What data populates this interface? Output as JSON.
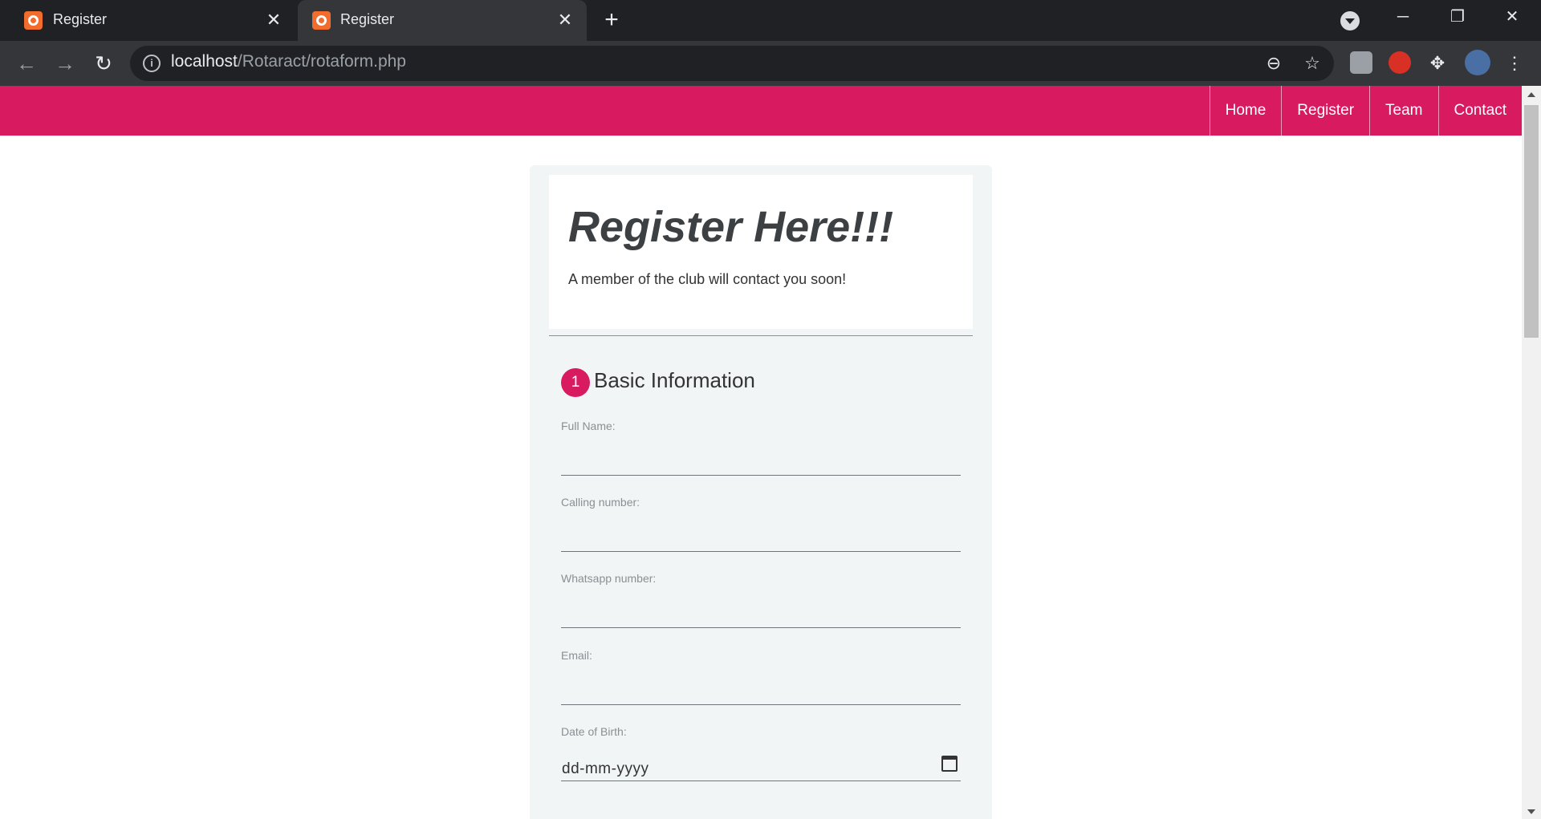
{
  "browser": {
    "tabs": [
      {
        "title": "Register",
        "active": false
      },
      {
        "title": "Register",
        "active": true
      }
    ],
    "url_host": "localhost",
    "url_path": "/Rotaract/rotaform.php",
    "icons": {
      "tab_close": "✕",
      "new_tab": "+",
      "back": "←",
      "forward": "→",
      "reload": "↻",
      "info": "i",
      "zoom": "⊖",
      "star": "☆",
      "puzzle": "✥",
      "menu": "⋮",
      "minimize": "─",
      "restore": "❐",
      "close": "✕"
    }
  },
  "nav": {
    "items": [
      "Home",
      "Register",
      "Team",
      "Contact"
    ],
    "accent": "#d81b60"
  },
  "form": {
    "title": "Register Here!!!",
    "subtitle": "A member of the club will contact you soon!",
    "section_number": "1",
    "section_title": "Basic Information",
    "fields": {
      "full_name": "Full Name:",
      "calling_number": "Calling number:",
      "whatsapp_number": "Whatsapp number:",
      "email": "Email:",
      "dob": "Date of Birth:",
      "dob_placeholder": "dd-mm-yyyy"
    }
  }
}
